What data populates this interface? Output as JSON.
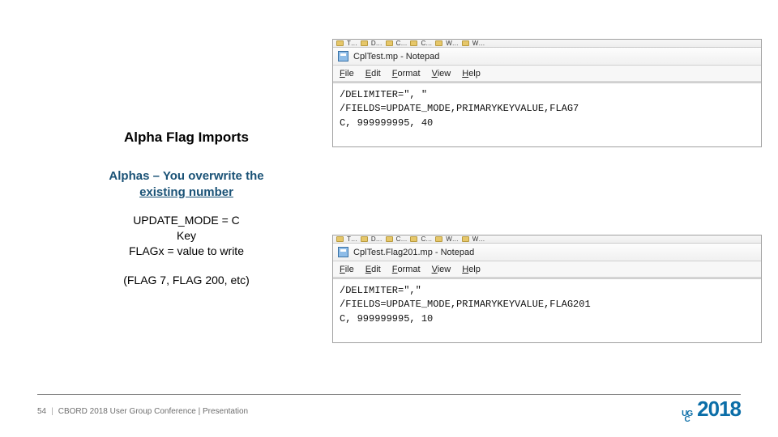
{
  "left": {
    "title": "Alpha Flag Imports",
    "subtitle_line1": "Alphas – You overwrite the",
    "subtitle_line2_underlined": "existing number",
    "body_line1": "UPDATE_MODE = C",
    "body_line2": "Key",
    "body_line3": "FLAGx = value to write",
    "body_example": "(FLAG 7, FLAG 200, etc)"
  },
  "notepad_top": {
    "frag_items": [
      "T…",
      "D…",
      "C…",
      "C…",
      "W…",
      "W…"
    ],
    "title": "CplTest.mp - Notepad",
    "menu": [
      "File",
      "Edit",
      "Format",
      "View",
      "Help"
    ],
    "lines": [
      "/DELIMITER=\", \"",
      "/FIELDS=UPDATE_MODE,PRIMARYKEYVALUE,FLAG7",
      "C, 999999995, 40"
    ]
  },
  "notepad_bottom": {
    "frag_items": [
      "T…",
      "D…",
      "C…",
      "C…",
      "W…",
      "W…"
    ],
    "title": "CplTest.Flag201.mp - Notepad",
    "menu": [
      "File",
      "Edit",
      "Format",
      "View",
      "Help"
    ],
    "lines": [
      "/DELIMITER=\",\"",
      "/FIELDS=UPDATE_MODE,PRIMARYKEYVALUE,FLAG201",
      "C, 999999995, 10"
    ]
  },
  "footer": {
    "page": "54",
    "text": "CBORD 2018 User Group Conference | Presentation",
    "logo_top": "UG",
    "logo_bottom": "C",
    "logo_year": "2018"
  }
}
